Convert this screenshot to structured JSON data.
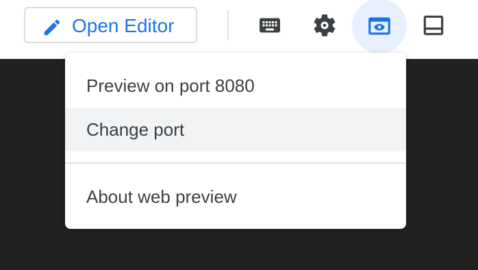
{
  "toolbar": {
    "open_editor_label": "Open Editor",
    "icons": {
      "pencil": "pencil-icon",
      "keyboard": "keyboard-icon",
      "settings": "gear-icon",
      "web_preview": "web-preview-icon",
      "panel": "panel-bottom-icon"
    },
    "accent_color": "#1a73e8",
    "active_bg": "#e8f0fe"
  },
  "menu": {
    "items": [
      {
        "label": "Preview on port 8080",
        "highlighted": false
      },
      {
        "label": "Change port",
        "highlighted": true
      },
      {
        "label": "About web preview",
        "highlighted": false
      }
    ]
  },
  "colors": {
    "terminal_bg": "#212121",
    "toolbar_bg": "#ffffff",
    "menu_text": "#3c4043",
    "icon_color": "#3c4043"
  }
}
